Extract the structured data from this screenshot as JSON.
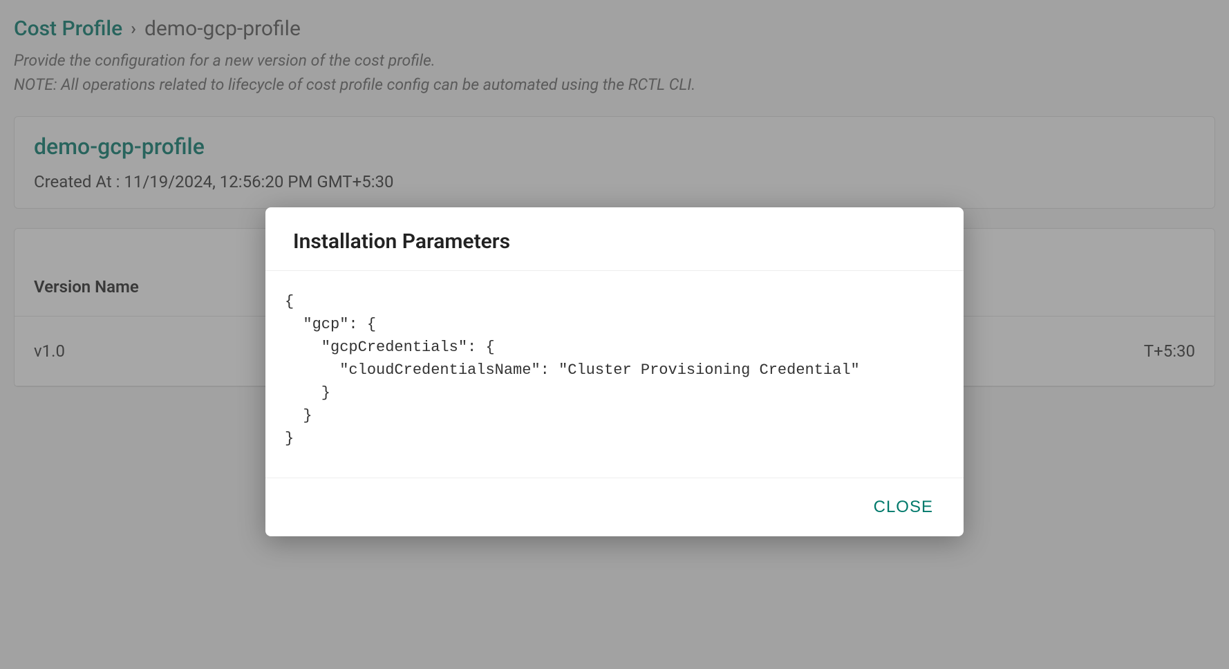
{
  "breadcrumb": {
    "root": "Cost Profile",
    "separator": "›",
    "current": "demo-gcp-profile"
  },
  "subtitle": {
    "line1": "Provide the configuration for a new version of the cost profile.",
    "line2": "NOTE: All operations related to lifecycle of cost profile config can be automated using the RCTL CLI."
  },
  "profile": {
    "name": "demo-gcp-profile",
    "created_at_label": "Created At :",
    "created_at_value": "11/19/2024, 12:56:20 PM GMT+5:30"
  },
  "table": {
    "header": "Version Name",
    "rows": [
      {
        "version": "v1.0",
        "right": "T+5:30"
      }
    ]
  },
  "modal": {
    "title": "Installation Parameters",
    "body": "{\n  \"gcp\": {\n    \"gcpCredentials\": {\n      \"cloudCredentialsName\": \"Cluster Provisioning Credential\"\n    }\n  }\n}",
    "close_label": "CLOSE"
  }
}
